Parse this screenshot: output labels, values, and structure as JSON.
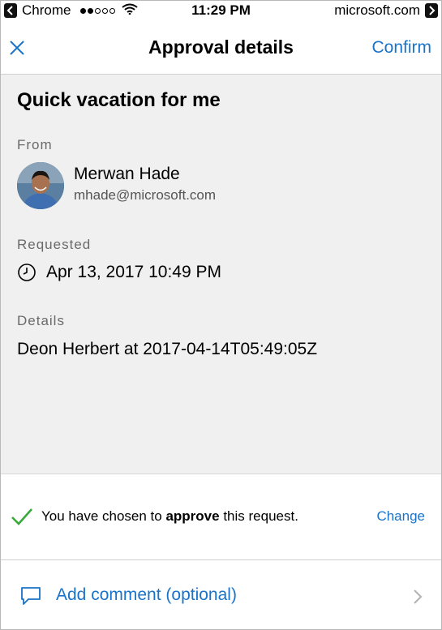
{
  "status_bar": {
    "app": "Chrome",
    "time": "11:29 PM",
    "domain": "microsoft.com",
    "signal_full": 2,
    "signal_total": 5
  },
  "nav": {
    "title": "Approval details",
    "confirm_label": "Confirm",
    "close_icon": "close-icon"
  },
  "request": {
    "title": "Quick vacation for me",
    "from_label": "From",
    "sender_name": "Merwan Hade",
    "sender_email": "mhade@microsoft.com",
    "requested_label": "Requested",
    "requested_date": "Apr 13, 2017 10:49 PM",
    "details_label": "Details",
    "details_text": "Deon Herbert at 2017-04-14T05:49:05Z"
  },
  "approval": {
    "prefix": "You have chosen to ",
    "decision": "approve",
    "suffix": " this request.",
    "change_label": "Change",
    "accent": "#3aa83a"
  },
  "comment": {
    "label": "Add comment (optional)"
  },
  "colors": {
    "link": "#1a73c9",
    "content_bg": "#f0f0f0"
  }
}
